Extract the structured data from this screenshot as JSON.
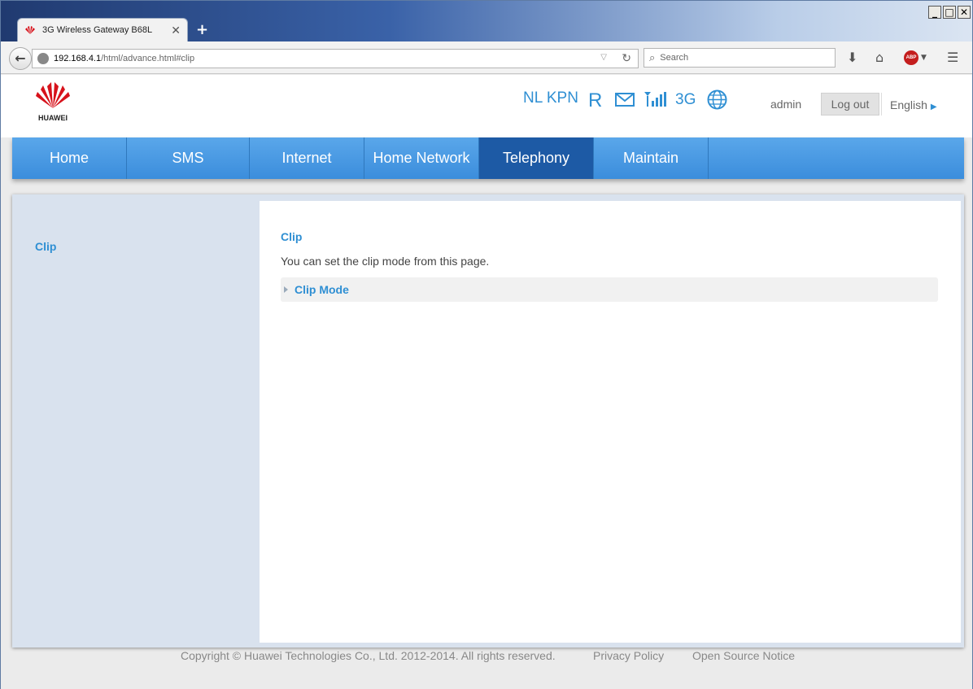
{
  "browser": {
    "tab_title": "3G Wireless Gateway B68L",
    "url_host": "192.168.4.1",
    "url_path": "/html/advance.html#clip",
    "search_placeholder": "Search",
    "abp_label": "ABP"
  },
  "header": {
    "brand": "HUAWEI",
    "operator": "NL KPN",
    "roaming": "R",
    "network_type": "3G",
    "user": "admin",
    "logout_label": "Log out",
    "language": "English"
  },
  "nav": [
    "Home",
    "SMS",
    "Internet",
    "Home Network",
    "Telephony",
    "Maintain"
  ],
  "nav_active": "Telephony",
  "sidebar": {
    "items": [
      "Clip"
    ]
  },
  "main": {
    "title": "Clip",
    "description": "You can set the clip mode from this page.",
    "section_label": "Clip Mode"
  },
  "footer": {
    "copyright": "Copyright © Huawei Technologies Co., Ltd. 2012-2014. All rights reserved.",
    "privacy": "Privacy Policy",
    "open_source": "Open Source Notice"
  },
  "colors": {
    "accent": "#2f8fd3",
    "nav": "#3b8ddc",
    "nav_active": "#1d5aa5",
    "brand_red": "#d7121b"
  }
}
